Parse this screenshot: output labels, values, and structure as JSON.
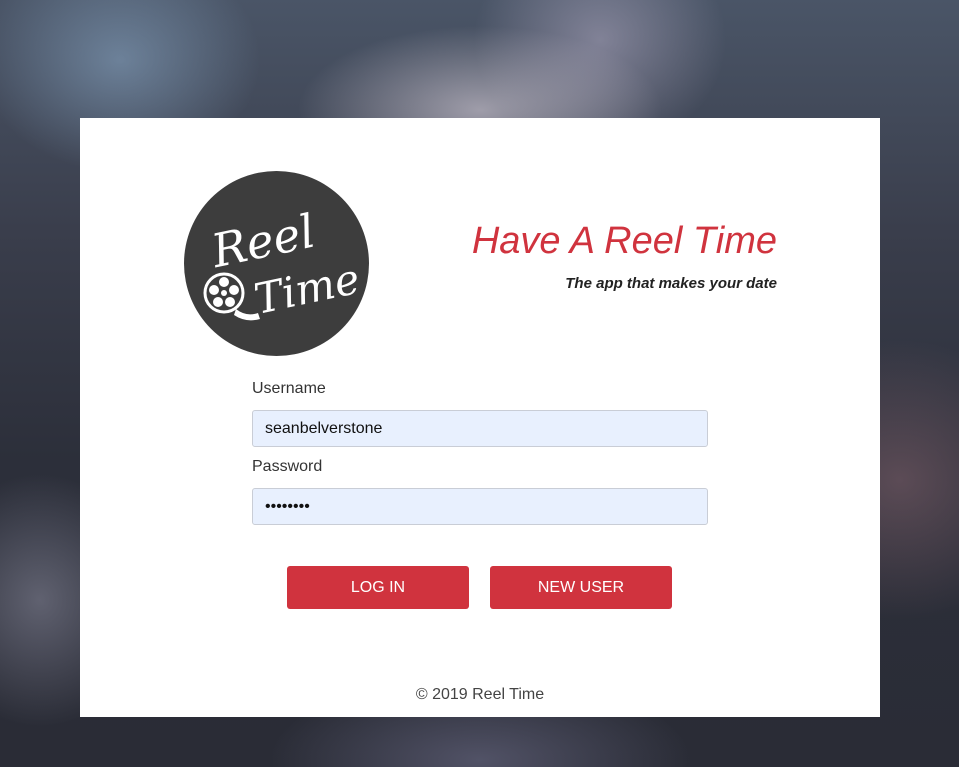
{
  "logo": {
    "line1": "Reel",
    "line2": "Time",
    "circle_color": "#3d3d3d"
  },
  "header": {
    "headline": "Have A Reel Time",
    "tagline": "The app that makes your date"
  },
  "form": {
    "username_label": "Username",
    "username_value": "seanbelverstone",
    "password_label": "Password",
    "password_value": "sean1234"
  },
  "buttons": {
    "login_label": "LOG IN",
    "new_user_label": "NEW USER"
  },
  "footer": {
    "copyright": "© 2019 Reel Time"
  },
  "colors": {
    "accent": "#d0333e",
    "input_bg": "#e8f0fe",
    "card_bg": "#ffffff"
  }
}
